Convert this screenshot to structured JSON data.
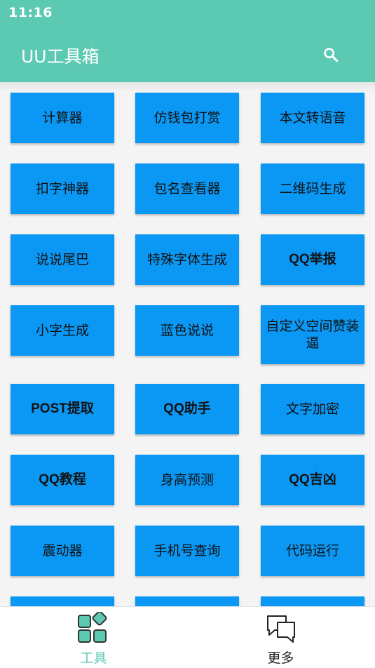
{
  "status_bar": {
    "time": "11:16"
  },
  "app_bar": {
    "title": "UU工具箱",
    "search_icon": "search-icon"
  },
  "tools": [
    "计算器",
    "仿钱包打赏",
    "本文转语音",
    "扣字神器",
    "包名查看器",
    "二维码生成",
    "说说尾巴",
    "特殊字体生成",
    "QQ举报",
    "小字生成",
    "蓝色说说",
    "自定义空间赞装逼",
    "POST提取",
    "QQ助手",
    "文字加密",
    "QQ教程",
    "身高预测",
    "QQ吉凶",
    "震动器",
    "手机号查询",
    "代码运行"
  ],
  "bottom_nav": {
    "tools_label": "工具",
    "more_label": "更多"
  },
  "colors": {
    "primary": "#5cc9b3",
    "tile": "#0b98f5"
  }
}
